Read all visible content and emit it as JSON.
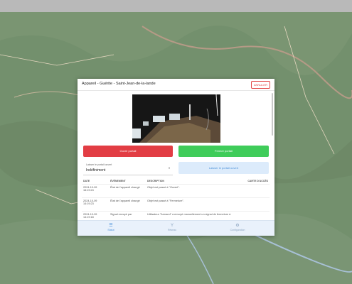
{
  "modal": {
    "title": "Appareil - Guérite - Saint-Jean-de-la-lande",
    "cancel_label": "ANNULER"
  },
  "actions": {
    "open_label": "Ouvrir portail",
    "close_label": "Fermer portail",
    "leave_open_label": "Laisser le portail ouvert"
  },
  "leave_open": {
    "label": "Laisser le portail ouvert",
    "value": "Indéfiniment"
  },
  "table": {
    "headers": [
      "DATE",
      "ÉVÉNEMENT",
      "DESCRIPTION",
      "CARTE D'ACCÈS"
    ],
    "rows": [
      {
        "date": "2024-10-09 16:19:24",
        "event": "État de l'appareil changé",
        "description": "Objet est passé à \"Ouvert\".",
        "card": ""
      },
      {
        "date": "2024-10-09 14:19:23",
        "event": "État de l'appareil changé",
        "description": "Objet est passé à \"Fermeture\".",
        "card": ""
      },
      {
        "date": "2024-10-09 14:19:18",
        "event": "Signal envoyé par",
        "description": "Utilisateur \"Armand\" a envoyé manuellement un signal de fermeture à",
        "card": ""
      }
    ]
  },
  "nav": {
    "items": [
      {
        "label": "Statut",
        "icon": "list-icon"
      },
      {
        "label": "Réseau",
        "icon": "network-icon"
      },
      {
        "label": "Configuration",
        "icon": "settings-icon"
      }
    ]
  }
}
